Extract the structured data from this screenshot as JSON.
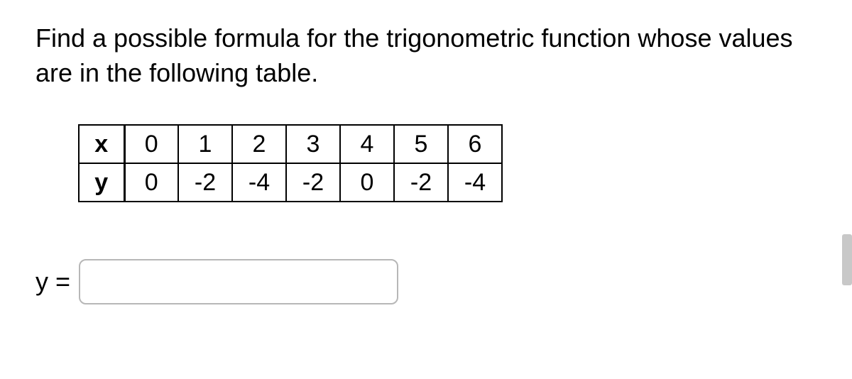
{
  "question": {
    "prompt": "Find a possible formula for the trigonometric function whose values are in the following table."
  },
  "table": {
    "rows": [
      {
        "label": "x",
        "cells": [
          "0",
          "1",
          "2",
          "3",
          "4",
          "5",
          "6"
        ]
      },
      {
        "label": "y",
        "cells": [
          "0",
          "-2",
          "-4",
          "-2",
          "0",
          "-2",
          "-4"
        ]
      }
    ]
  },
  "answer": {
    "label": "y =",
    "value": "",
    "placeholder": ""
  }
}
